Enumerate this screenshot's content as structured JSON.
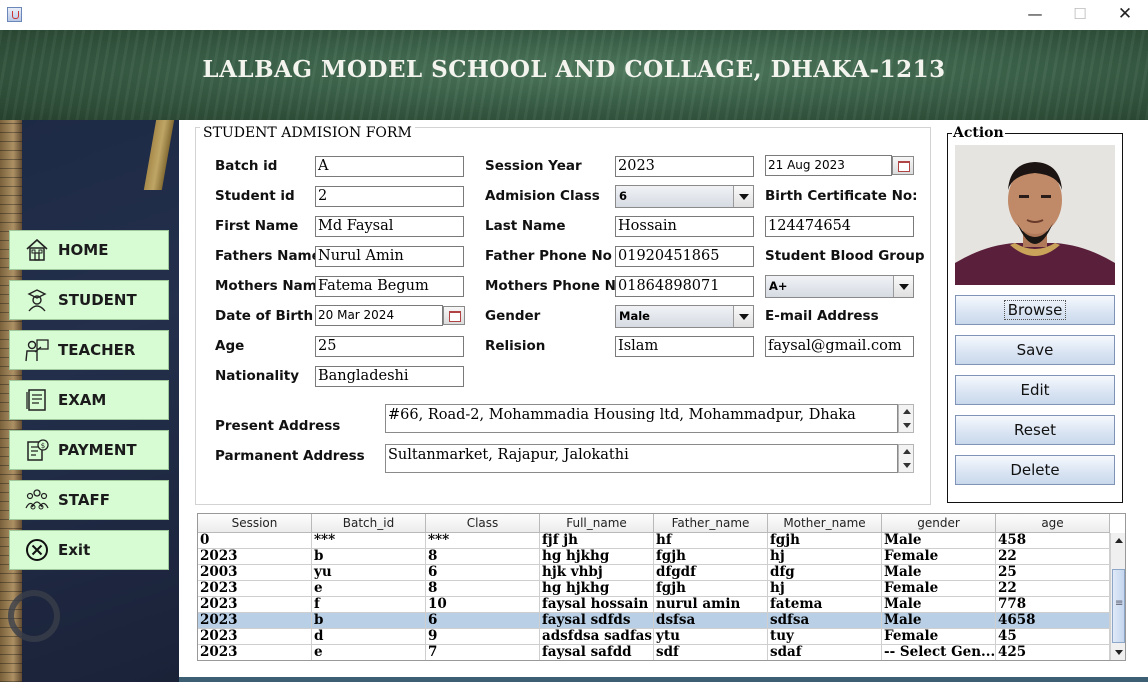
{
  "window": {
    "minimize": "—",
    "maximize": "☐",
    "close": "✕"
  },
  "banner": {
    "title": "LALBAG MODEL SCHOOL AND COLLAGE, DHAKA-1213"
  },
  "sidebar": {
    "items": [
      {
        "label": "HOME",
        "icon": "home-icon"
      },
      {
        "label": "STUDENT",
        "icon": "student-icon"
      },
      {
        "label": "TEACHER",
        "icon": "teacher-icon"
      },
      {
        "label": "EXAM",
        "icon": "exam-icon"
      },
      {
        "label": "PAYMENT",
        "icon": "payment-icon"
      },
      {
        "label": "STAFF",
        "icon": "staff-icon"
      },
      {
        "label": "Exit",
        "icon": "exit-icon"
      }
    ]
  },
  "form": {
    "title": "STUDENT ADMISION FORM",
    "labels": {
      "batch_id": "Batch id",
      "student_id": "Student id",
      "first_name": "First Name",
      "fathers_name": "Fathers Name",
      "mothers_name": "Mothers Name",
      "date_of_birth": "Date of Birth",
      "age": "Age",
      "nationality": "Nationality",
      "session_year": "Session Year",
      "admision_class": "Admision Class",
      "last_name": "Last Name",
      "father_phone": "Father Phone No",
      "mothers_phone": "Mothers Phone No",
      "gender": "Gender",
      "relision": "Relision",
      "birth_certificate": "Birth Certificate No:",
      "blood_group": "Student Blood Group",
      "email": "E-mail Address",
      "present_address": "Present Address",
      "permanent_address": "Parmanent Address"
    },
    "values": {
      "batch_id": "A",
      "student_id": "2",
      "first_name": "Md Faysal",
      "fathers_name": "Nurul Amin",
      "mothers_name": "Fatema Begum",
      "date_of_birth": "20 Mar 2024",
      "age": "25",
      "nationality": "Bangladeshi",
      "session_year": "2023",
      "session_date": "21 Aug 2023",
      "admision_class": "6",
      "last_name": "Hossain",
      "father_phone": "01920451865",
      "mothers_phone": "01864898071",
      "gender": "Male",
      "relision": "Islam",
      "birth_certificate": "124474654",
      "blood_group": "A+",
      "email": "faysal@gmail.com",
      "present_address": "#66, Road-2, Mohammadia Housing ltd, Mohammadpur, Dhaka",
      "permanent_address": "Sultanmarket, Rajapur, Jalokathi"
    }
  },
  "action": {
    "title": "Action",
    "buttons": {
      "browse": "Browse",
      "save": "Save",
      "edit": "Edit",
      "reset": "Reset",
      "delete": "Delete"
    }
  },
  "table": {
    "columns": [
      "Session",
      "Batch_id",
      "Class",
      "Full_name",
      "Father_name",
      "Mother_name",
      "gender",
      "age"
    ],
    "rows": [
      [
        "0",
        "***",
        "***",
        "fjf jh",
        "hf",
        "fgjh",
        "Male",
        "458"
      ],
      [
        "2023",
        "b",
        "8",
        "hg hjkhg",
        "fgjh",
        "hj",
        "Female",
        "22"
      ],
      [
        "2003",
        "yu",
        "6",
        "hjk vhbj",
        "dfgdf",
        "dfg",
        "Male",
        "25"
      ],
      [
        "2023",
        "e",
        "8",
        "hg hjkhg",
        "fgjh",
        "hj",
        "Female",
        "22"
      ],
      [
        "2023",
        "f",
        "10",
        "faysal hossain",
        "nurul amin",
        "fatema",
        "Male",
        "778"
      ],
      [
        "2023",
        "b",
        "6",
        "faysal sdfds",
        "dsfsa",
        "sdfsa",
        "Male",
        "4658"
      ],
      [
        "2023",
        "d",
        "9",
        "adsfdsa sadfas",
        "ytu",
        "tuy",
        "Female",
        "45"
      ],
      [
        "2023",
        "e",
        "7",
        "faysal safdd",
        "sdf",
        "sdaf",
        "-- Select Gen...",
        "425"
      ]
    ],
    "selected_row_index": 5
  }
}
